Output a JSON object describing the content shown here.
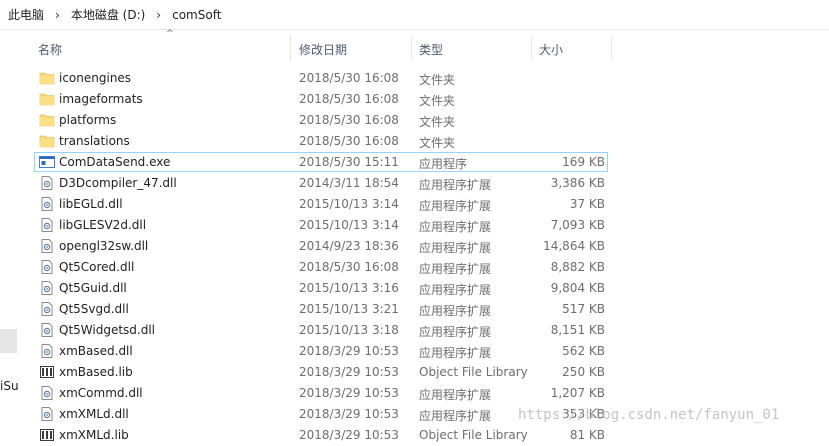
{
  "breadcrumb": {
    "items": [
      "此电脑",
      "本地磁盘 (D:)",
      "comSoft"
    ],
    "separator": "›"
  },
  "left_panel": {
    "partial_text": "iSu"
  },
  "columns": [
    {
      "label": "名称"
    },
    {
      "label": "修改日期"
    },
    {
      "label": "类型"
    },
    {
      "label": "大小"
    }
  ],
  "sort_indicator": "^",
  "files": [
    {
      "name": "iconengines",
      "date": "2018/5/30 16:08",
      "type": "文件夹",
      "size": "",
      "icon": "folder-icon"
    },
    {
      "name": "imageformats",
      "date": "2018/5/30 16:08",
      "type": "文件夹",
      "size": "",
      "icon": "folder-icon"
    },
    {
      "name": "platforms",
      "date": "2018/5/30 16:08",
      "type": "文件夹",
      "size": "",
      "icon": "folder-icon"
    },
    {
      "name": "translations",
      "date": "2018/5/30 16:08",
      "type": "文件夹",
      "size": "",
      "icon": "folder-icon"
    },
    {
      "name": "ComDataSend.exe",
      "date": "2018/5/30 15:11",
      "type": "应用程序",
      "size": "169 KB",
      "icon": "exe-icon",
      "selected": true
    },
    {
      "name": "D3Dcompiler_47.dll",
      "date": "2014/3/11 18:54",
      "type": "应用程序扩展",
      "size": "3,386 KB",
      "icon": "dll-icon"
    },
    {
      "name": "libEGLd.dll",
      "date": "2015/10/13 3:14",
      "type": "应用程序扩展",
      "size": "37 KB",
      "icon": "dll-icon"
    },
    {
      "name": "libGLESV2d.dll",
      "date": "2015/10/13 3:14",
      "type": "应用程序扩展",
      "size": "7,093 KB",
      "icon": "dll-icon"
    },
    {
      "name": "opengl32sw.dll",
      "date": "2014/9/23 18:36",
      "type": "应用程序扩展",
      "size": "14,864 KB",
      "icon": "dll-icon"
    },
    {
      "name": "Qt5Cored.dll",
      "date": "2018/5/30 16:08",
      "type": "应用程序扩展",
      "size": "8,882 KB",
      "icon": "dll-icon"
    },
    {
      "name": "Qt5Guid.dll",
      "date": "2015/10/13 3:16",
      "type": "应用程序扩展",
      "size": "9,804 KB",
      "icon": "dll-icon"
    },
    {
      "name": "Qt5Svgd.dll",
      "date": "2015/10/13 3:21",
      "type": "应用程序扩展",
      "size": "517 KB",
      "icon": "dll-icon"
    },
    {
      "name": "Qt5Widgetsd.dll",
      "date": "2015/10/13 3:18",
      "type": "应用程序扩展",
      "size": "8,151 KB",
      "icon": "dll-icon"
    },
    {
      "name": "xmBased.dll",
      "date": "2018/3/29 10:53",
      "type": "应用程序扩展",
      "size": "562 KB",
      "icon": "dll-icon"
    },
    {
      "name": "xmBased.lib",
      "date": "2018/3/29 10:53",
      "type": "Object File Library",
      "size": "250 KB",
      "icon": "lib-icon"
    },
    {
      "name": "xmCommd.dll",
      "date": "2018/3/29 10:53",
      "type": "应用程序扩展",
      "size": "1,207 KB",
      "icon": "dll-icon"
    },
    {
      "name": "xmXMLd.dll",
      "date": "2018/3/29 10:53",
      "type": "应用程序扩展",
      "size": "353 KB",
      "icon": "dll-icon"
    },
    {
      "name": "xmXMLd.lib",
      "date": "2018/3/29 10:53",
      "type": "Object File Library",
      "size": "81 KB",
      "icon": "lib-icon"
    }
  ],
  "watermark": "https://blog.csdn.net/fanyun_01",
  "colors": {
    "folder": "#f8d775",
    "selection_border": "#99d1ff",
    "header_text": "#4d5a6a",
    "detail_text": "#6d6d6d"
  }
}
